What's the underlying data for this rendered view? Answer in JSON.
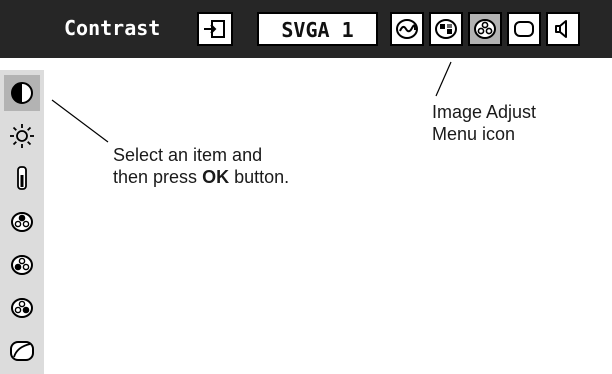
{
  "menu": {
    "title": "Contrast",
    "input_label": "SVGA 1",
    "icons": [
      "input-icon",
      "pc-adjust-icon",
      "picture-select-icon",
      "image-adjust-icon",
      "screen-icon",
      "sound-icon"
    ],
    "selected_icon": "image-adjust-icon"
  },
  "sidebar": {
    "items": [
      "contrast-icon",
      "brightness-icon",
      "color-temp-icon",
      "white-balance-red-icon",
      "white-balance-green-icon",
      "white-balance-blue-icon",
      "sharpness-icon"
    ],
    "selected_item": "contrast-icon"
  },
  "callouts": {
    "image_adjust_line1": "Image Adjust",
    "image_adjust_line2": "Menu icon",
    "select_line1": "Select an item and",
    "select_prefix": "then press ",
    "select_ok": "OK",
    "select_suffix": " button."
  },
  "colors": {
    "menubar": "#262626",
    "highlight": "#b3b3b3",
    "sidebar": "#dcdcdc",
    "text": "#1a1a1a"
  }
}
